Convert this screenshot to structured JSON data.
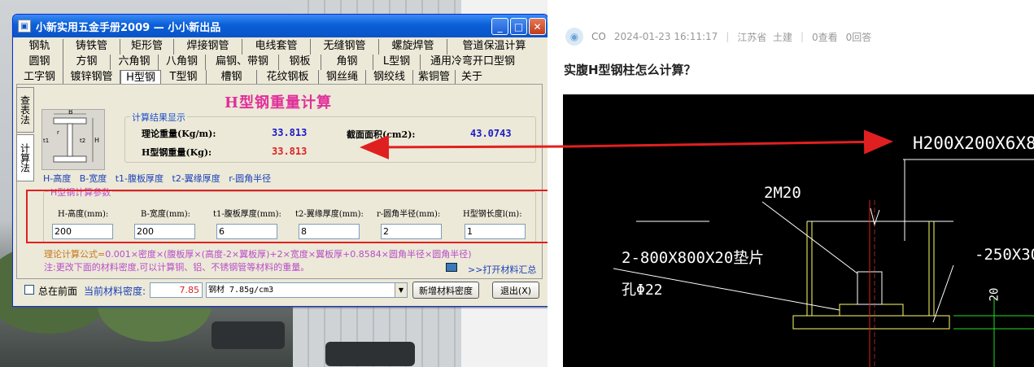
{
  "window": {
    "title": "小新实用五金手册2009 — 小小新出品",
    "controls": {
      "minimize": "_",
      "maximize": "□",
      "close": "✕"
    }
  },
  "tabs": {
    "row1": [
      "钢轨",
      "铸铁管",
      "矩形管",
      "焊接钢管",
      "电线套管",
      "无缝钢管",
      "螺旋焊管",
      "管道保温计算"
    ],
    "row2": [
      "圆钢",
      "方钢",
      "六角钢",
      "八角钢",
      "扁钢、带钢",
      "钢板",
      "角钢",
      "L型钢",
      "通用冷弯开口型钢"
    ],
    "row3": [
      "工字钢",
      "镀锌钢管",
      "H型钢",
      "T型钢",
      "槽钢",
      "花纹钢板",
      "钢丝绳",
      "钢绞线",
      "紫铜管",
      "关于"
    ],
    "active": "H型钢"
  },
  "side_tabs": [
    "查表法",
    "计算法"
  ],
  "diagram": {
    "labels": [
      "B",
      "H",
      "t1",
      "t2",
      "r"
    ]
  },
  "main_title": "H型钢重量计算",
  "results": {
    "legend": "计算结果显示",
    "theory_weight_label": "理论重量(Kg/m):",
    "theory_weight_value": "33.813",
    "section_area_label": "截面面积(cm2):",
    "section_area_value": "43.0743",
    "h_weight_label": "H型钢重量(Kg):",
    "h_weight_value": "33.813"
  },
  "hint_line": "H-高度   B-宽度   t1-腹板厚度   t2-翼缘厚度   r-圆角半径",
  "params": {
    "legend": "H型钢计算参数",
    "fields": [
      {
        "label": "H-高度(mm):",
        "value": "200"
      },
      {
        "label": "B-宽度(mm):",
        "value": "200"
      },
      {
        "label": "t1-腹板厚度(mm):",
        "value": "6"
      },
      {
        "label": "t2-翼缘厚度(mm):",
        "value": "8"
      },
      {
        "label": "r-圆角半径(mm):",
        "value": "2"
      },
      {
        "label": "H型钢长度l(m):",
        "value": "1"
      }
    ]
  },
  "formula": {
    "prefix": "理论计算公式=",
    "body": "0.001×密度×(腹板厚×(高度-2×翼板厚)+2×宽度×翼板厚+0.8584×圆角半径×圆角半径)",
    "note": "注:更改下面的材料密度,可以计算铜、铝、不锈钢管等材料的重量。",
    "open_summary": ">>打开材料汇总"
  },
  "bottom": {
    "always_on_top": "总在前面",
    "density_label": "当前材料密度:",
    "density_value": "7.85",
    "material_select": "钢材 7.85g/cm3",
    "new_density_button": "新增材料密度",
    "exit_button": "退出(X)"
  },
  "post": {
    "user": "CO",
    "date": "2024-01-23 16:11:17",
    "location": "江苏省  土建",
    "views": "0查看",
    "replies": "0回答",
    "title": "实腹H型钢柱怎么计算？"
  },
  "cad": {
    "label_section": "H200X200X6X8",
    "label_bolts": "2M20",
    "label_plate": "2-800X800X20垫片",
    "label_hole": "孔Φ22",
    "label_right": "-250X30",
    "label_dim": "20"
  },
  "colors": {
    "annotation_red": "#e02020",
    "title_pink": "#e0309a",
    "value_blue": "#1a1ac8",
    "value_red": "#e02020"
  }
}
